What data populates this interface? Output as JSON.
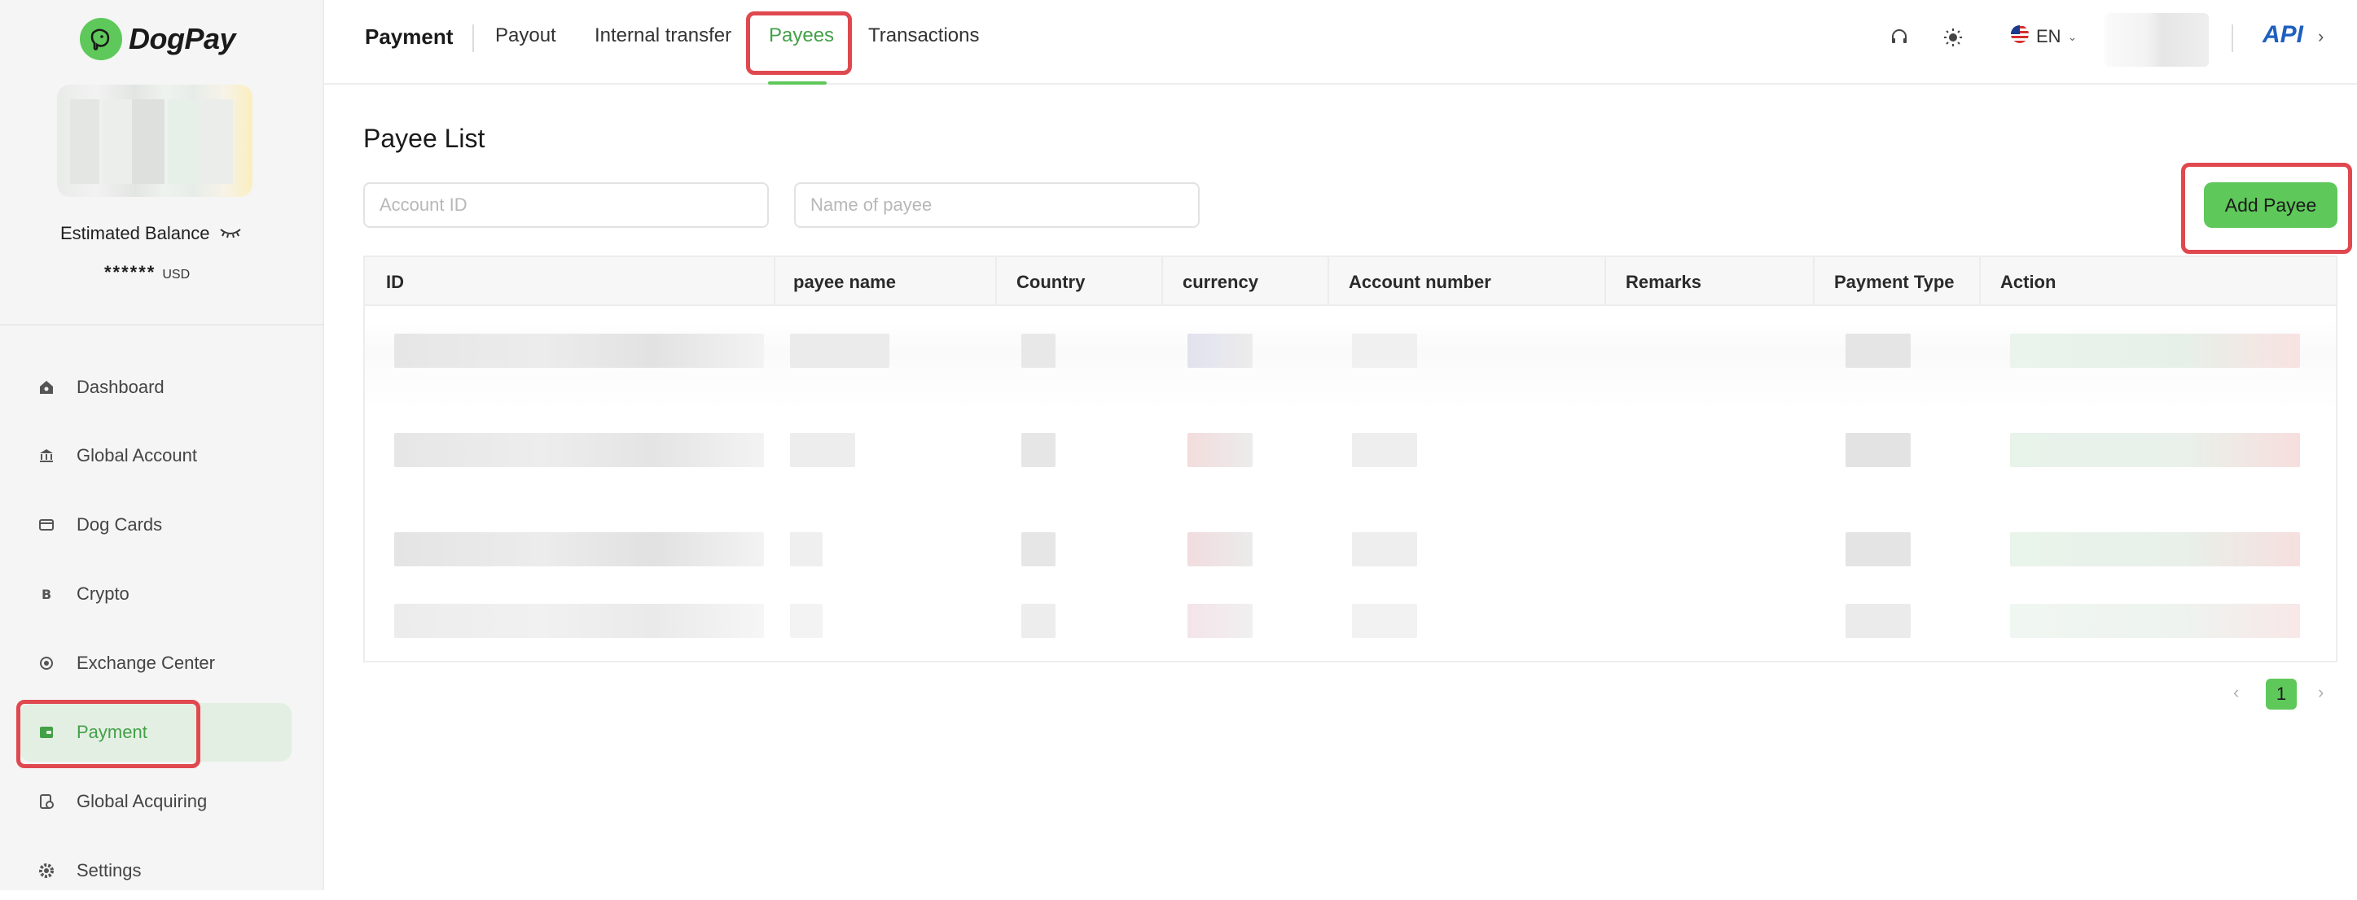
{
  "brand": {
    "name": "DogPay"
  },
  "sidebar": {
    "balance_label": "Estimated Balance",
    "balance_value": "******",
    "balance_currency": "USD",
    "items": [
      {
        "label": "Dashboard",
        "icon": "home-icon"
      },
      {
        "label": "Global Account",
        "icon": "bank-icon"
      },
      {
        "label": "Dog Cards",
        "icon": "card-icon"
      },
      {
        "label": "Crypto",
        "icon": "bitcoin-icon"
      },
      {
        "label": "Exchange Center",
        "icon": "exchange-icon"
      },
      {
        "label": "Payment",
        "icon": "wallet-icon",
        "active": true
      },
      {
        "label": "Global Acquiring",
        "icon": "acquiring-icon"
      },
      {
        "label": "Settings",
        "icon": "gear-icon"
      }
    ]
  },
  "header": {
    "title": "Payment",
    "tabs": [
      {
        "label": "Payout"
      },
      {
        "label": "Internal transfer"
      },
      {
        "label": "Payees",
        "active": true
      },
      {
        "label": "Transactions"
      }
    ],
    "language": "EN",
    "api_label": "API"
  },
  "main": {
    "page_title": "Payee List",
    "account_id_placeholder": "Account ID",
    "payee_name_placeholder": "Name of payee",
    "add_button": "Add Payee",
    "table": {
      "columns": [
        "ID",
        "payee name",
        "Country",
        "currency",
        "Account number",
        "Remarks",
        "Payment Type",
        "Action"
      ]
    },
    "pagination": {
      "current_page": "1"
    }
  },
  "colors": {
    "accent": "#5ec85a",
    "accent_text": "#43a047",
    "highlight": "#e0484f",
    "api_blue": "#1f5fbf"
  }
}
